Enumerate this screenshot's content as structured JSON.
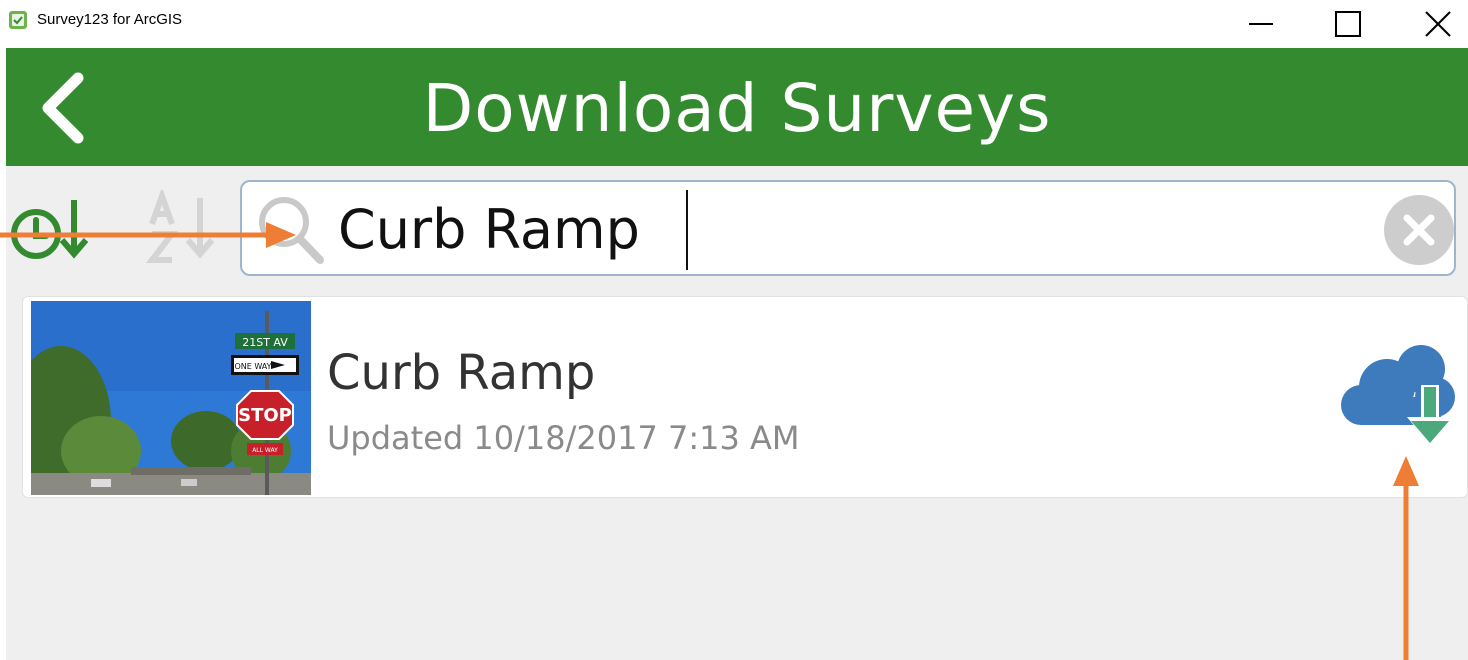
{
  "window": {
    "title": "Survey123 for ArcGIS",
    "minimize_icon": "minimize-icon",
    "maximize_icon": "maximize-icon",
    "close_icon": "close-icon"
  },
  "header": {
    "title": "Download Surveys",
    "back_icon": "chevron-left-icon",
    "background": "#348a2f"
  },
  "toolbar": {
    "sort_by_date_icon": "clock-sort-down-icon",
    "sort_by_name_icon": "alpha-sort-down-icon",
    "sort_active_color": "#348a2f",
    "sort_inactive_color": "#d4d4d4"
  },
  "search": {
    "value": "Curb Ramp",
    "icon": "search-icon",
    "clear_icon": "clear-icon"
  },
  "results": [
    {
      "title": "Curb Ramp",
      "updated": "Updated 10/18/2017 7:13 AM",
      "thumbnail_signs": {
        "street": "21ST AV",
        "oneway": "ONE WAY",
        "stop": "STOP",
        "allway": "ALL WAY"
      },
      "download_icon": "cloud-download-icon"
    }
  ],
  "colors": {
    "annotation": "#ee7d35",
    "cloud": "#3e7bbd",
    "download_arrow": "#4ba97b"
  }
}
